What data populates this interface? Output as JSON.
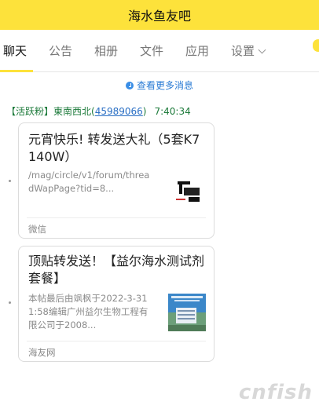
{
  "header": {
    "title": "海水鱼友吧"
  },
  "tabs": [
    {
      "label": "聊天",
      "active": true
    },
    {
      "label": "公告"
    },
    {
      "label": "相册"
    },
    {
      "label": "文件"
    },
    {
      "label": "应用"
    },
    {
      "label": "设置"
    }
  ],
  "more_messages": "查看更多消息",
  "message": {
    "badge": "【活跃粉】",
    "name": "東南西北",
    "uid_open": "(",
    "uid": "45989066",
    "uid_close": ")",
    "time": "7:40:34"
  },
  "cards": [
    {
      "title": "元宵快乐! 转发送大礼（5套K7 140W）",
      "desc": "/mag/circle/v1/forum/threadWapPage?tid=8...",
      "source": "微信",
      "thumb_icon": "product-thumbnail"
    },
    {
      "title": "顶贴转发送！【益尔海水测试剂套餐】",
      "desc": "本帖最后由飒枫于2022-3-311:58编辑广州益尔生物工程有限公司于2008...",
      "source": "海友网",
      "thumb_icon": "building-thumbnail"
    }
  ],
  "watermark": "cnfish"
}
